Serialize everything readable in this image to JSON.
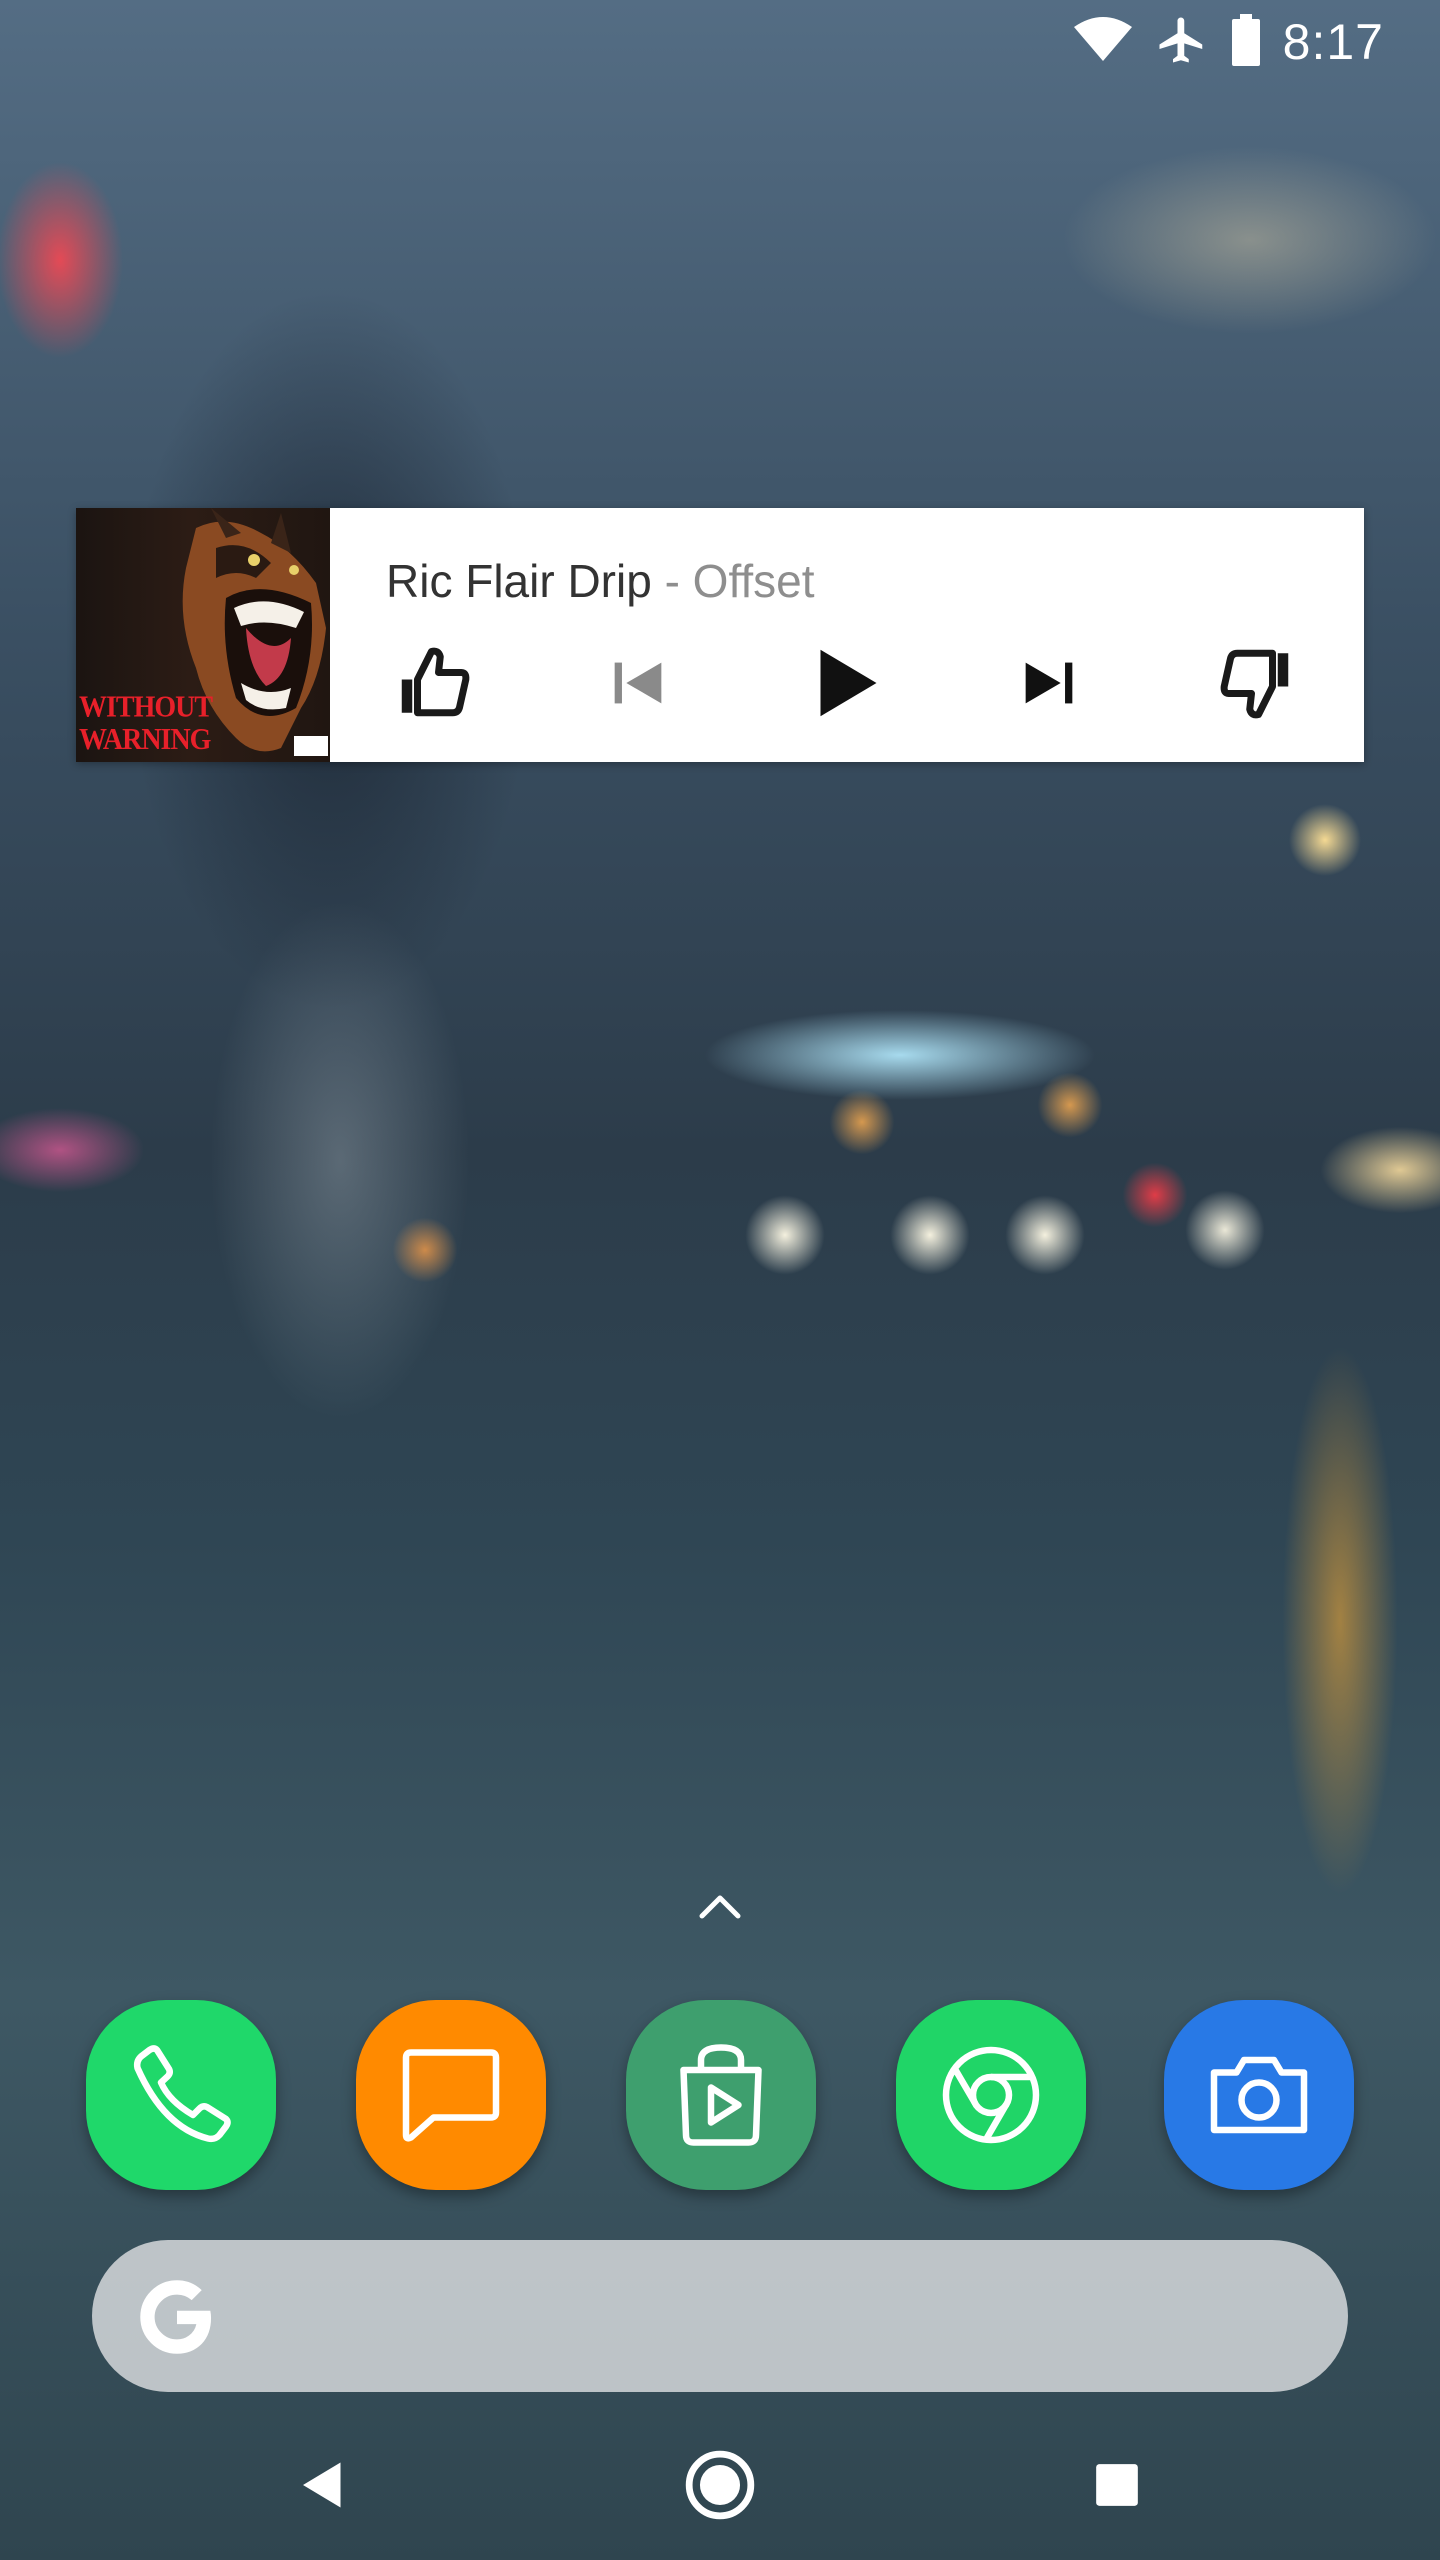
{
  "status_bar": {
    "time": "8:17",
    "icons": [
      "wifi-icon",
      "airplane-mode-icon",
      "battery-icon"
    ]
  },
  "music_widget": {
    "song_title": "Ric Flair Drip",
    "separator": "-",
    "artist": "Offset",
    "album_art_text": "WITHOUT WARNING",
    "controls": [
      "thumbs-up-icon",
      "previous-track-icon",
      "play-icon",
      "next-track-icon",
      "thumbs-down-icon"
    ],
    "previous_disabled": true
  },
  "dock": {
    "apps": [
      {
        "name": "Phone",
        "icon": "phone-icon",
        "color": "#1fd86a"
      },
      {
        "name": "Messages",
        "icon": "message-icon",
        "color": "#ff8a00"
      },
      {
        "name": "Play Store",
        "icon": "play-store-icon",
        "color": "#3e9f6e"
      },
      {
        "name": "Chrome",
        "icon": "chrome-icon",
        "color": "#20d567"
      },
      {
        "name": "Camera",
        "icon": "camera-icon",
        "color": "#2879e6"
      }
    ]
  },
  "search_bar": {
    "logo": "google-g-icon"
  },
  "nav_bar": {
    "buttons": [
      "back-icon",
      "home-icon",
      "recents-icon"
    ]
  },
  "colors": {
    "widget_bg": "#ffffff",
    "title_text": "#333333",
    "artist_text": "#8e8e8e",
    "album_red": "#e8202a"
  }
}
